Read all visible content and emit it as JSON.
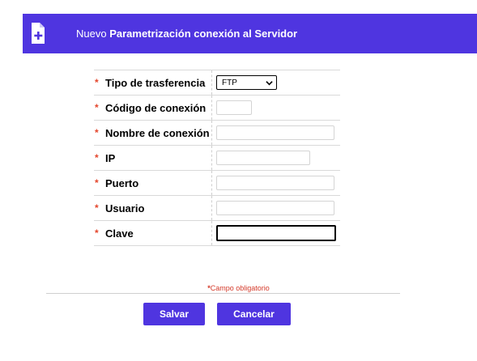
{
  "header": {
    "prefix": "Nuevo",
    "title": "Parametrización conexión al Servidor",
    "icon": "document-add-icon"
  },
  "form": {
    "required_mark": "*",
    "fields": [
      {
        "label": "Tipo de trasferencia",
        "type": "select",
        "value": "FTP"
      },
      {
        "label": "Código de conexión",
        "type": "text",
        "value": ""
      },
      {
        "label": "Nombre de conexión",
        "type": "text",
        "value": ""
      },
      {
        "label": "IP",
        "type": "text",
        "value": ""
      },
      {
        "label": "Puerto",
        "type": "text",
        "value": ""
      },
      {
        "label": "Usuario",
        "type": "text",
        "value": ""
      },
      {
        "label": "Clave",
        "type": "password",
        "value": ""
      }
    ]
  },
  "footer": {
    "required_note": "Campo obligatorio",
    "save_label": "Salvar",
    "cancel_label": "Cancelar"
  },
  "colors": {
    "accent": "#4f35e0",
    "required": "#e4472d"
  }
}
